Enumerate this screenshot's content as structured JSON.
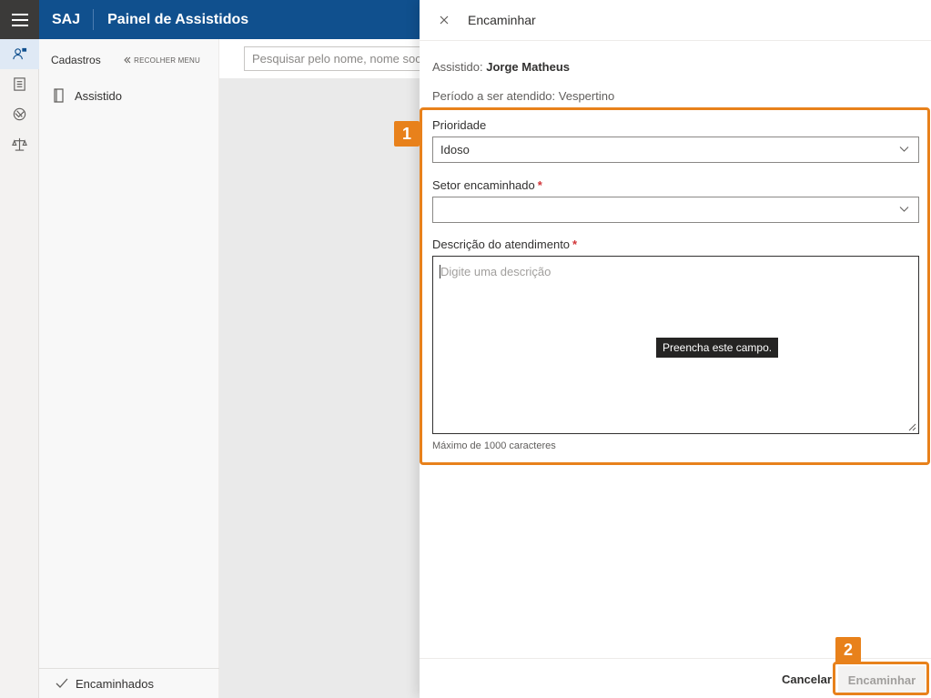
{
  "header": {
    "brand": "SAJ",
    "title": "Painel de Assistidos"
  },
  "rail": {
    "items": [
      {
        "icon": "person-badge-icon",
        "active": true
      },
      {
        "icon": "list-document-icon",
        "active": false
      },
      {
        "icon": "handshake-icon",
        "active": false
      },
      {
        "icon": "scales-icon",
        "active": false
      }
    ]
  },
  "sidenav": {
    "title": "Cadastros",
    "collapse_label": "RECOLHER MENU",
    "items": [
      {
        "label": "Assistido",
        "icon": "book-icon"
      }
    ],
    "footer_label": "Encaminhados"
  },
  "main": {
    "search_placeholder": "Pesquisar pelo nome, nome social"
  },
  "panel": {
    "title": "Encaminhar",
    "assistido_label": "Assistido:",
    "assistido_name": "Jorge Matheus",
    "periodo_text": "Período a ser atendido: Vespertino",
    "prioridade_label": "Prioridade",
    "prioridade_value": "Idoso",
    "setor_label": "Setor encaminhado",
    "setor_value": "",
    "descricao_label": "Descrição do atendimento",
    "descricao_placeholder": "Digite uma descrição",
    "descricao_hint": "Máximo de 1000 caracteres",
    "tooltip": "Preencha este campo.",
    "required_mark": "*",
    "cancel_label": "Cancelar",
    "submit_label": "Encaminhar"
  },
  "annotations": {
    "badge_1": "1",
    "badge_2": "2",
    "color": "#e8811b"
  },
  "colors": {
    "header": "#10508e",
    "rail_dark": "#3b3a39",
    "required": "#d13438"
  }
}
